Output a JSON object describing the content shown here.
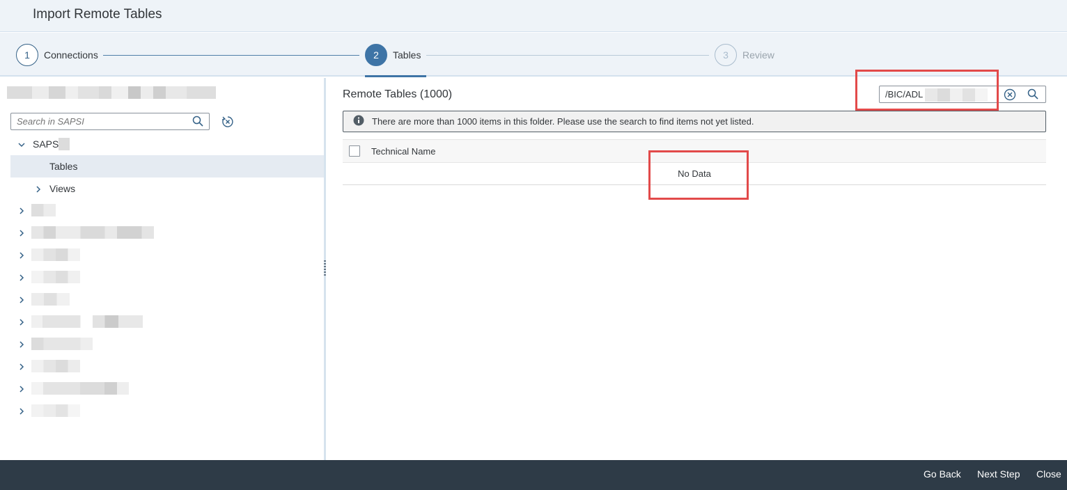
{
  "header": {
    "title": "Import Remote Tables"
  },
  "wizard": {
    "steps": [
      {
        "number": "1",
        "label": "Connections"
      },
      {
        "number": "2",
        "label": "Tables"
      },
      {
        "number": "3",
        "label": "Review"
      }
    ]
  },
  "left_panel": {
    "search_placeholder": "Search in SAPSI",
    "tree": {
      "root": "SAPS",
      "children": [
        "Tables",
        "Views"
      ]
    }
  },
  "right_panel": {
    "title": "Remote Tables (1000)",
    "filter_value": "/BIC/ADL",
    "message": "There are more than 1000 items in this folder. Please use the search to find items not yet listed.",
    "column_header": "Technical Name",
    "no_data": "No Data"
  },
  "footer": {
    "go_back": "Go Back",
    "next_step": "Next Step",
    "close": "Close"
  },
  "colors": {
    "accent": "#3e74a6",
    "header_bg": "#eef3f8",
    "footer_bg": "#2e3b47",
    "highlight": "#e24a4a"
  }
}
